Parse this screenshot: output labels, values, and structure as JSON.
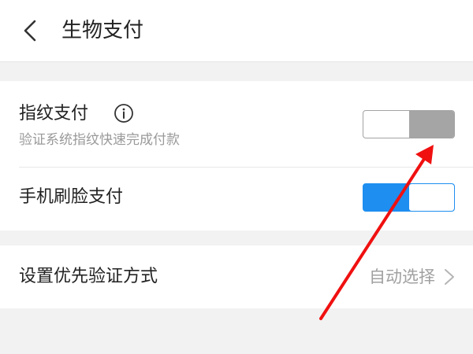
{
  "header": {
    "title": "生物支付",
    "back_icon": "chevron-left-icon"
  },
  "fingerprint": {
    "title": "指纹支付",
    "subtitle": "验证系统指纹快速完成付款",
    "info_icon": "info-icon",
    "enabled": false
  },
  "face": {
    "title": "手机刷脸支付",
    "enabled": true
  },
  "verify_method": {
    "title": "设置优先验证方式",
    "value": "自动选择",
    "chevron_icon": "chevron-right-icon"
  },
  "colors": {
    "accent": "#1e8ef0",
    "toggle_off": "#a5a5a5",
    "annotation_arrow": "#f01010"
  }
}
